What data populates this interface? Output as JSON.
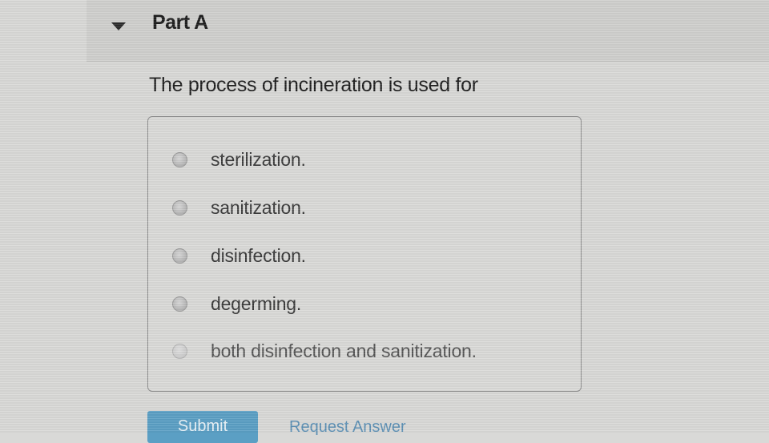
{
  "part": {
    "title": "Part A"
  },
  "question": {
    "text": "The process of incineration is used for"
  },
  "options": [
    {
      "label": "sterilization.",
      "selected": false
    },
    {
      "label": "sanitization.",
      "selected": false
    },
    {
      "label": "disinfection.",
      "selected": false
    },
    {
      "label": "degerming.",
      "selected": false
    },
    {
      "label": "both disinfection and sanitization.",
      "selected": false
    }
  ],
  "actions": {
    "submit_label": "Submit",
    "request_answer_label": "Request Answer"
  },
  "colors": {
    "submit_button": "#5b9fc4",
    "link": "#5b8fb4",
    "page_background": "#d9d9d7",
    "header_background": "#cfcfcd"
  },
  "icons": {
    "collapse": "triangle-down-icon"
  }
}
